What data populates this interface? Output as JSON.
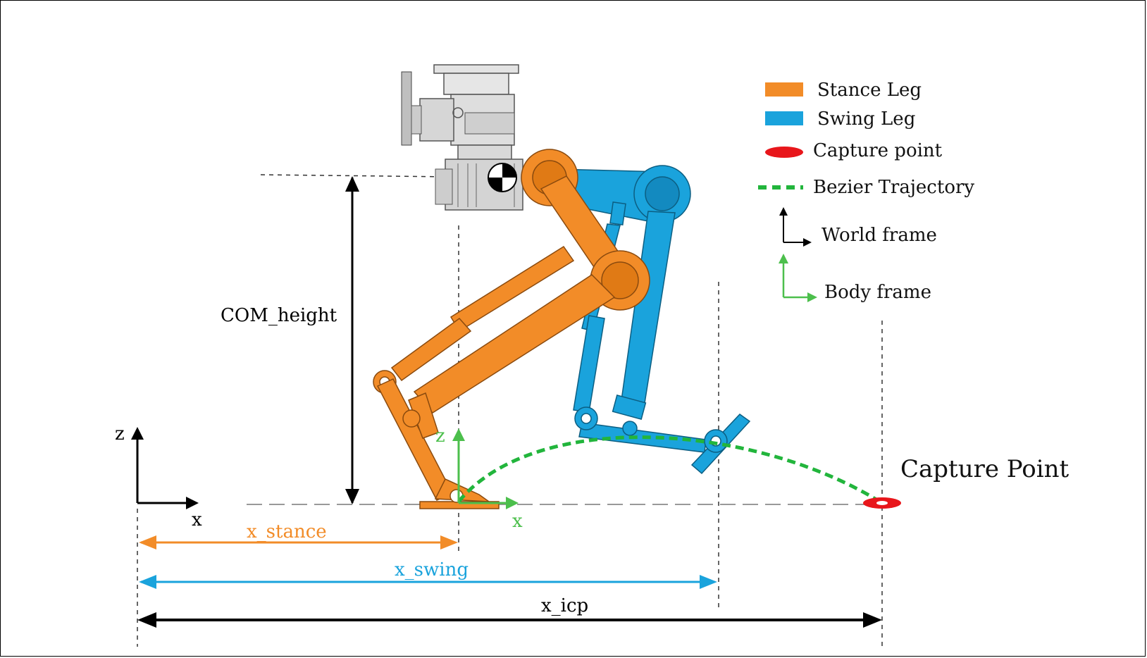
{
  "labels": {
    "com_height": "COM_height",
    "world_z": "z",
    "world_x": "x",
    "body_z": "z",
    "body_x": "x",
    "x_stance": "x_stance",
    "x_swing": "x_swing",
    "x_icp": "x_icp",
    "capture_point": "Capture Point"
  },
  "legend": {
    "items": [
      {
        "label": "Stance Leg",
        "color": "#f28c28",
        "icon": "orange-swatch"
      },
      {
        "label": "Swing Leg",
        "color": "#1aa3dc",
        "icon": "blue-swatch"
      },
      {
        "label": "Capture point",
        "color": "#e8161b",
        "icon": "red-ellipse"
      },
      {
        "label": "Bezier Trajectory",
        "color": "#22b53c",
        "icon": "green-dashed-line"
      },
      {
        "label": "World frame",
        "color": "#000000",
        "icon": "black-axes"
      },
      {
        "label": "Body frame",
        "color": "#4cbf4c",
        "icon": "green-axes"
      }
    ]
  },
  "colors": {
    "stance": "#f28c28",
    "swing": "#1aa3dc",
    "capture": "#e8161b",
    "trajectory": "#22b53c",
    "body_frame": "#4cbf4c",
    "robot_body": "#d9d9d9"
  }
}
